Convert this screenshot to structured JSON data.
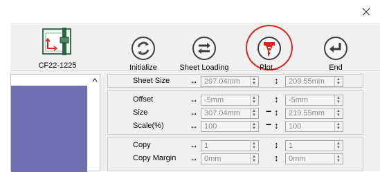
{
  "window": {
    "close_icon": "close-icon"
  },
  "device": {
    "label": "CF22-1225",
    "icon": "plotter-device-icon"
  },
  "toolbar": {
    "initialize": {
      "label": "Initialize",
      "icon": "refresh-icon"
    },
    "sheet_loading": {
      "label": "Sheet Loading",
      "icon": "swap-arrows-icon"
    },
    "plot": {
      "label": "Plot...",
      "icon": "plot-cutter-icon",
      "highlight_color": "#d9261c"
    },
    "end": {
      "label": "End",
      "icon": "return-arrow-icon"
    }
  },
  "settings": {
    "sheet_size": {
      "label": "Sheet Size",
      "width": "297.04mm",
      "height": "209.55mm"
    },
    "offset": {
      "label": "Offset",
      "width": "-5mm",
      "height": "-5mm"
    },
    "size": {
      "label": "Size",
      "width": "307.04mm",
      "height": "219.55mm"
    },
    "scale": {
      "label": "Scale(%)",
      "width": "100",
      "height": "100"
    },
    "copy": {
      "label": "Copy",
      "width": "1",
      "height": "1"
    },
    "copy_margin": {
      "label": "Copy Margin",
      "width": "0mm",
      "height": "0mm"
    }
  },
  "symbols": {
    "horizontal": "↔",
    "vertical": "↕",
    "link": "−"
  },
  "colors": {
    "accent_red": "#d9261c",
    "list_selection": "#6f6fb1"
  }
}
